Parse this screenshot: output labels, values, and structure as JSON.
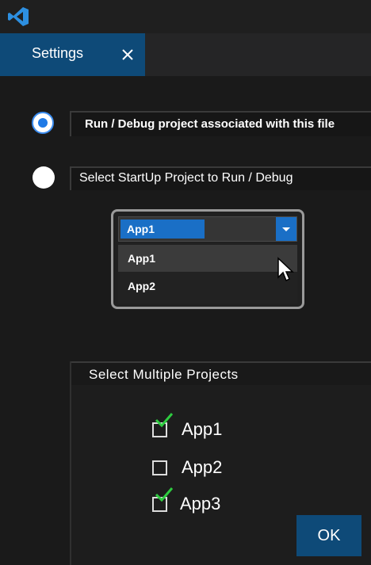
{
  "app": {
    "icon": "vscode-logo"
  },
  "tab": {
    "title": "Settings",
    "close_icon": "close-icon"
  },
  "options": {
    "run_associated": {
      "label": "Run / Debug project associated with this file",
      "selected": true
    },
    "startup": {
      "label": "Select  StartUp  Project  to  Run / Debug",
      "selected": false
    },
    "multiple": {
      "label": "Select  Multiple  Projects"
    }
  },
  "dropdown": {
    "selected": "App1",
    "items": [
      "App1",
      "App2"
    ],
    "hovered_index": 0
  },
  "projects": [
    {
      "label": "App1",
      "checked": true
    },
    {
      "label": "App2",
      "checked": false
    },
    {
      "label": "App3",
      "checked": true
    }
  ],
  "ok_label": "OK",
  "colors": {
    "accent": "#0e4a78",
    "selection": "#1a6fc6",
    "check": "#2ecc40"
  }
}
